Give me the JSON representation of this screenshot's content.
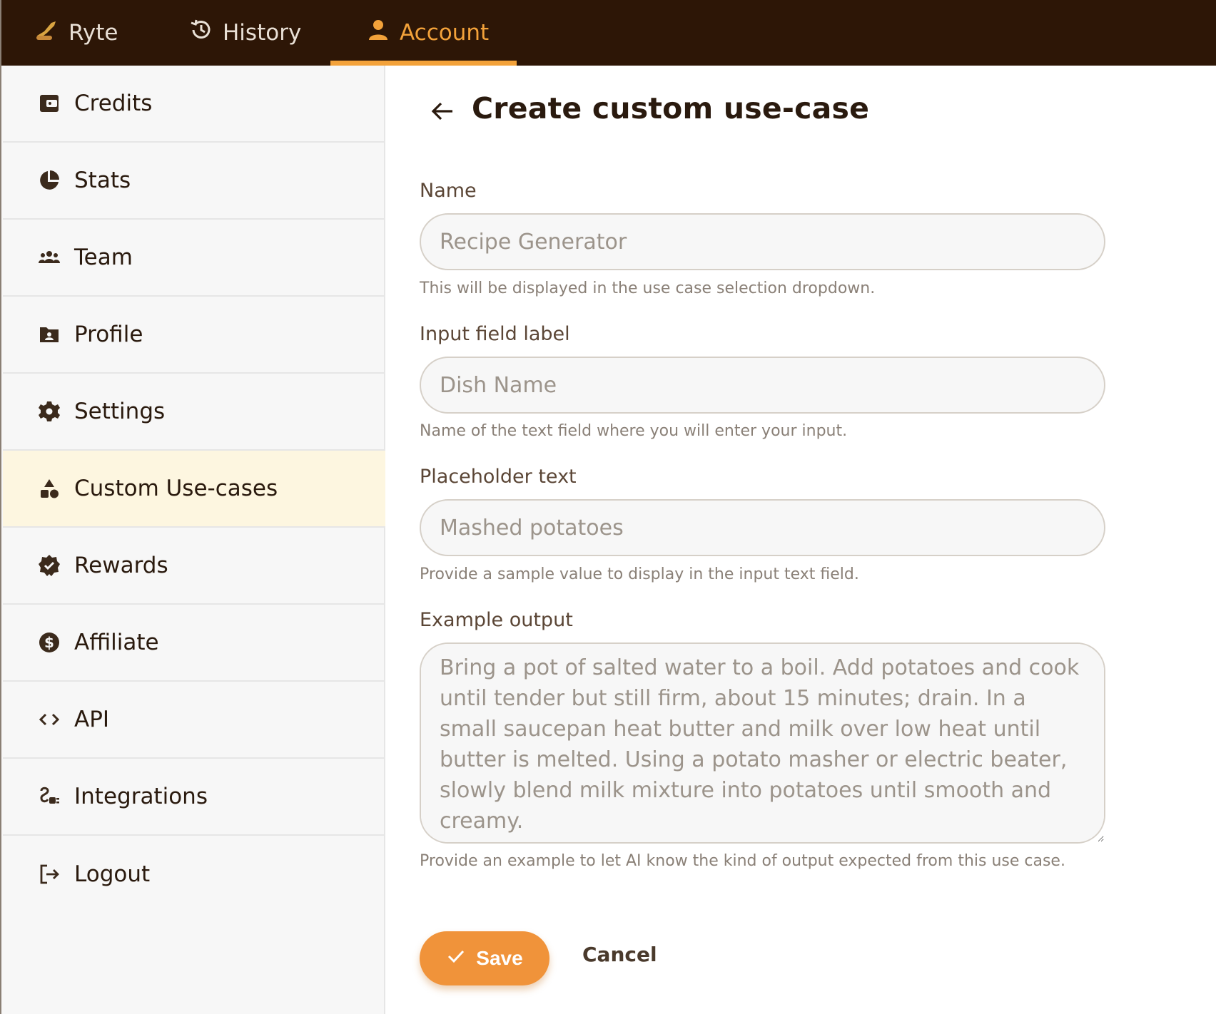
{
  "topbar": {
    "tabs": [
      {
        "label": "Ryte",
        "icon": "quill-hand-icon"
      },
      {
        "label": "History",
        "icon": "history-icon"
      },
      {
        "label": "Account",
        "icon": "user-icon",
        "active": true
      }
    ]
  },
  "sidebar": {
    "items": [
      {
        "label": "Credits",
        "icon": "wallet-icon"
      },
      {
        "label": "Stats",
        "icon": "pie-chart-icon"
      },
      {
        "label": "Team",
        "icon": "team-icon"
      },
      {
        "label": "Profile",
        "icon": "profile-folder-icon"
      },
      {
        "label": "Settings",
        "icon": "gear-icon"
      },
      {
        "label": "Custom Use-cases",
        "icon": "shapes-icon",
        "active": true
      },
      {
        "label": "Rewards",
        "icon": "badge-check-icon"
      },
      {
        "label": "Affiliate",
        "icon": "dollar-circle-icon"
      },
      {
        "label": "API",
        "icon": "code-icon"
      },
      {
        "label": "Integrations",
        "icon": "plug-icon"
      },
      {
        "label": "Logout",
        "icon": "logout-icon"
      }
    ]
  },
  "main": {
    "title": "Create custom use-case",
    "fields": {
      "name": {
        "label": "Name",
        "placeholder": "Recipe Generator",
        "value": "",
        "help": "This will be displayed in the use case selection dropdown."
      },
      "input_label": {
        "label": "Input field label",
        "placeholder": "Dish Name",
        "value": "",
        "help": "Name of the text field where you will enter your input."
      },
      "placeholder_text": {
        "label": "Placeholder text",
        "placeholder": "Mashed potatoes",
        "value": "",
        "help": "Provide a sample value to display in the input text field."
      },
      "example_output": {
        "label": "Example output",
        "placeholder": "Bring a pot of salted water to a boil. Add potatoes and cook until tender but still firm, about 15 minutes; drain. In a small saucepan heat butter and milk over low heat until butter is melted. Using a potato masher or electric beater, slowly blend milk mixture into potatoes until smooth and creamy.",
        "value": "",
        "help": "Provide an example to let AI know the kind of output expected from this use case."
      }
    },
    "actions": {
      "save_label": "Save",
      "cancel_label": "Cancel"
    }
  },
  "colors": {
    "topbar_bg": "#2d1606",
    "accent": "#f3a23a",
    "save_button": "#f0933a",
    "active_sidebar_bg": "#fdf6e0"
  }
}
